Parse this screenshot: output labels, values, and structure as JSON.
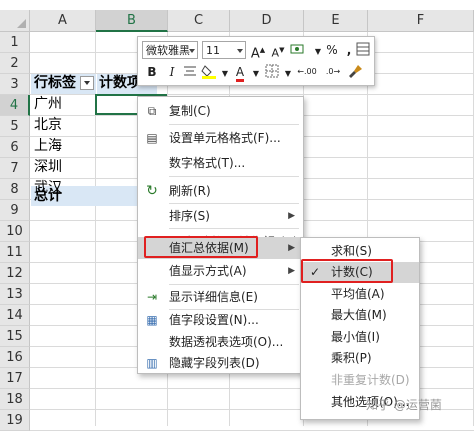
{
  "columns": [
    "A",
    "B",
    "C",
    "D",
    "E",
    "F"
  ],
  "rows": [
    "1",
    "2",
    "3",
    "4",
    "5",
    "6",
    "7",
    "8",
    "9",
    "10",
    "11",
    "12",
    "13",
    "14",
    "15",
    "16",
    "17",
    "18",
    "19"
  ],
  "pivot": {
    "row_label_header": "行标签",
    "value_header": "计数项:销售额",
    "first_value": "1",
    "cities": [
      "广州",
      "北京",
      "上海",
      "深圳",
      "武汉"
    ],
    "total": "总计"
  },
  "mini_toolbar": {
    "font_name": "微软雅黑",
    "font_size": "11",
    "grow_font": "A",
    "shrink_font": "A",
    "percent": "%",
    "comma": ",",
    "bold": "B",
    "italic": "I",
    "font_color_letter": "A",
    "decimal_up": ".00",
    "decimal_down": ".0"
  },
  "context_menu": {
    "items": [
      {
        "label": "复制(C)",
        "icon": "copy-icon",
        "glyph": "⧉"
      },
      {
        "label": "设置单元格格式(F)...",
        "icon": "format-cells-icon",
        "glyph": "▤"
      },
      {
        "label": "数字格式(T)...",
        "icon": "",
        "glyph": ""
      },
      {
        "label": "刷新(R)",
        "icon": "refresh-icon",
        "glyph": "↻"
      },
      {
        "label": "排序(S)",
        "icon": "",
        "glyph": "",
        "arrow": "▶"
      },
      {
        "label": "删除\"计数项:销售额\"(V)",
        "icon": "delete-x-icon",
        "glyph": "✕"
      },
      {
        "label": "值汇总依据(M)",
        "icon": "",
        "glyph": "",
        "arrow": "▶"
      },
      {
        "label": "值显示方式(A)",
        "icon": "",
        "glyph": "",
        "arrow": "▶"
      },
      {
        "label": "显示详细信息(E)",
        "icon": "show-detail-icon",
        "glyph": "⇥"
      },
      {
        "label": "值字段设置(N)...",
        "icon": "field-settings-icon",
        "glyph": "▦"
      },
      {
        "label": "数据透视表选项(O)...",
        "icon": "",
        "glyph": ""
      },
      {
        "label": "隐藏字段列表(D)",
        "icon": "field-list-icon",
        "glyph": "▥"
      }
    ]
  },
  "submenu": {
    "items": [
      {
        "label": "求和(S)",
        "checked": false,
        "disabled": false
      },
      {
        "label": "计数(C)",
        "checked": true,
        "disabled": false
      },
      {
        "label": "平均值(A)",
        "checked": false,
        "disabled": false
      },
      {
        "label": "最大值(M)",
        "checked": false,
        "disabled": false
      },
      {
        "label": "最小值(I)",
        "checked": false,
        "disabled": false
      },
      {
        "label": "乘积(P)",
        "checked": false,
        "disabled": false
      },
      {
        "label": "非重复计数(D)",
        "checked": false,
        "disabled": true
      },
      {
        "label": "其他选项(O)...",
        "checked": false,
        "disabled": false
      }
    ],
    "check_glyph": "✓"
  },
  "watermark": "知乎 @运营菌",
  "colors": {
    "accent": "#217346",
    "highlight_box": "#e02020",
    "pivot_header_bg": "#d9e7f5"
  }
}
